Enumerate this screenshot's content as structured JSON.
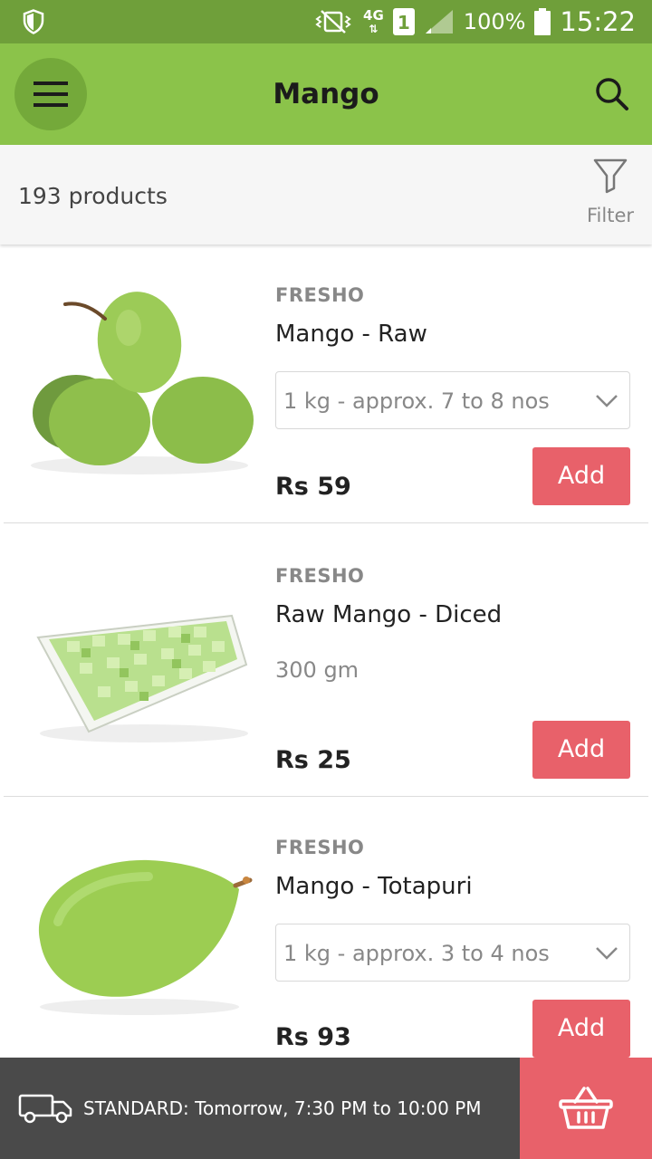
{
  "status_bar": {
    "network": "4G",
    "sim": "1",
    "battery": "100%",
    "time": "15:22"
  },
  "app_bar": {
    "title": "Mango"
  },
  "sub_header": {
    "count": "193 products",
    "filter_label": "Filter"
  },
  "products": [
    {
      "brand": "FRESHO",
      "name": "Mango - Raw",
      "size": "1 kg - approx. 7 to 8 nos",
      "price": "Rs 59",
      "add_label": "Add"
    },
    {
      "brand": "FRESHO",
      "name": "Raw Mango - Diced",
      "size": "300 gm",
      "price": "Rs 25",
      "add_label": "Add"
    },
    {
      "brand": "FRESHO",
      "name": "Mango - Totapuri",
      "size": "1 kg - approx. 3 to 4 nos",
      "price": "Rs 93",
      "add_label": "Add"
    }
  ],
  "bottom_bar": {
    "delivery_text": "STANDARD: Tomorrow, 7:30 PM to 10:00 PM"
  },
  "colors": {
    "status_bar": "#6f9f3a",
    "app_bar": "#8bc34a",
    "accent": "#e8616a",
    "bottom_bar": "#4a4a4a"
  }
}
